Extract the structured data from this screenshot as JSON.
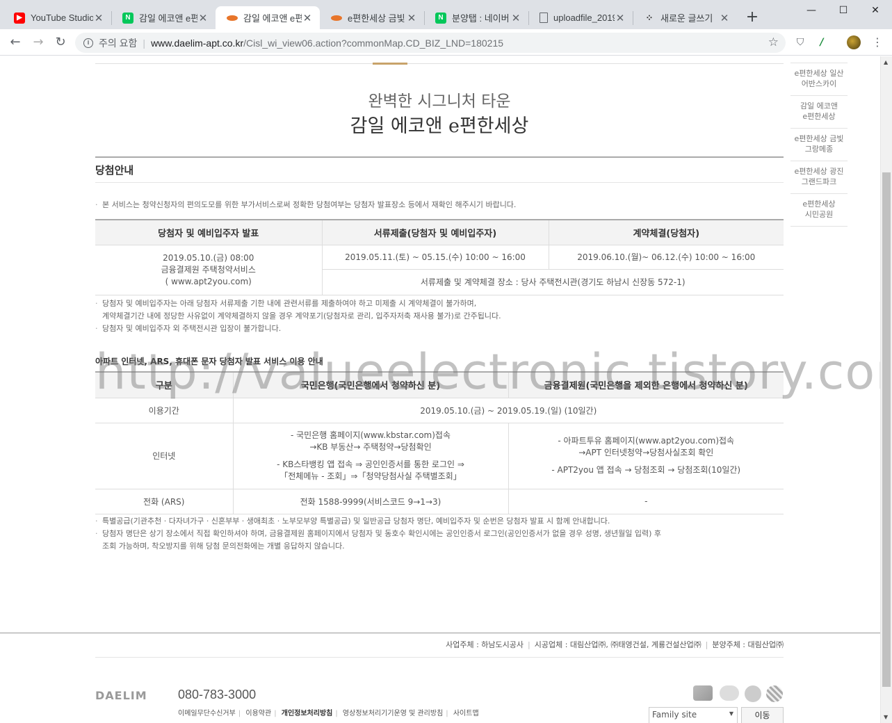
{
  "browser": {
    "tabs": [
      {
        "title": "YouTube Studio",
        "icon": "youtube-icon",
        "color": "#ff0000"
      },
      {
        "title": "감일 에코앤 e편",
        "icon": "naver-icon",
        "color": "#03c75a"
      },
      {
        "title": "감일 에코앤 e편",
        "icon": "daelim-icon",
        "color": "#e8752a",
        "active": true
      },
      {
        "title": "e편한세상 금빛",
        "icon": "daelim-icon",
        "color": "#e8752a"
      },
      {
        "title": "분양탭 : 네이버",
        "icon": "naver-icon",
        "color": "#03c75a"
      },
      {
        "title": "uploadfile_2019",
        "icon": "document-icon",
        "color": "#5f6368"
      },
      {
        "title": "새로운 글쓰기",
        "icon": "tistory-icon",
        "color": "#333333"
      }
    ],
    "security_warning": "주의 요함",
    "url_host": "www.daelim-apt.co.kr",
    "url_path": "/Cisl_wi_view06.action?commonMap.CD_BIZ_LND=180215"
  },
  "hero": {
    "subtitle": "완벽한 시그니처 타운",
    "title": "감일 에코앤 e편한세상"
  },
  "section": {
    "title": "당첨안내",
    "intro_note": "본 서비스는 청약신청자의 편의도모를 위한 부가서비스로써 정확한 당첨여부는 당첨자 발표장소 등에서 재확인 해주시기 바랍니다."
  },
  "schedule_table": {
    "headers": [
      "당첨자 및 예비입주자 발표",
      "서류제출(당첨자 및 예비입주자)",
      "계약체결(당첨자)"
    ],
    "announce": [
      "2019.05.10.(금) 08:00",
      "금융결제원 주택청약서비스",
      "( www.apt2you.com)"
    ],
    "docs_period": "2019.05.11.(토) ~ 05.15.(수) 10:00 ~ 16:00",
    "contract_period": "2019.06.10.(월)~ 06.12.(수) 10:00 ~ 16:00",
    "place": "서류제출 및 계약체결 장소 : 당사 주택전시관(경기도 하남시 신장동 572-1)"
  },
  "notes_1": [
    "당첨자 및 예비입주자는 아래 당첨자 서류제출 기한 내에 관련서류를 제출하여야 하고 미제출 시 계약체결이 불가하며,",
    "계약체결기간 내에 정당한 사유없이 계약체결하지 않을 경우 계약포기(당첨자로 관리, 입주자저축 재사용 불가)로 간주됩니다.",
    "당첨자 및 예비입주자 외 주택전시관 입장이 불가합니다."
  ],
  "service": {
    "title": "아파트 인터넷, ARS, 휴대폰 문자 당첨자 발표 서비스 이용 안내",
    "headers": [
      "구분",
      "국민은행(국민은행에서 청약하신 분)",
      "금융결제원(국민은행을 제외한 은행에서 청약하신 분)"
    ],
    "period_label": "이용기간",
    "period_value": "2019.05.10.(금) ~ 2019.05.19.(일) (10일간)",
    "internet_label": "인터넷",
    "kb_internet": [
      "- 국민은행 홈페이지(www.kbstar.com)접속",
      "→KB 부동산→ 주택청약→당첨확인",
      "- KB스타뱅킹 앱 접속 ⇒ 공인인증서를 통한 로그인 ⇒",
      "「전체메뉴 - 조회」⇒「청약당첨사실 주택별조회」"
    ],
    "kftc_internet": [
      "- 아파트투유 홈페이지(www.apt2you.com)접속",
      "→APT 인터넷청약→당첨사실조회 확인",
      "- APT2you 앱 접속 → 당첨조회 → 당첨조회(10일간)"
    ],
    "ars_label": "전화 (ARS)",
    "kb_ars": "전화 1588-9999(서비스코드 9→1→3)",
    "kftc_ars": "-"
  },
  "notes_2": [
    "특별공급(기관추천 · 다자녀가구 · 신혼부부 · 생애최초 · 노부모부양 특별공급) 및 일반공급 당첨자 명단, 예비입주자 및 순번은 당첨자 발표 시 함께 안내합니다.",
    "당첨자 명단은 상기 장소에서 직접 확인하셔야 하며, 금융결제원 홈페이지에서 당첨자 및 동호수 확인시에는 공인인증서 로그인(공인인증서가 없을 경우 성명, 생년월일 입력) 후",
    "조회 가능하며, 착오방지를 위해 당첨 문의전화에는 개별 응답하지 않습니다."
  ],
  "quick_nav": [
    "e편한세상 일산\n어반스카이",
    "감일 에코앤\ne편한세상",
    "e편한세상 금빛\n그랑메종",
    "e편한세상 광진\n그랜드파크",
    "e편한세상\n시민공원"
  ],
  "watermark": "http://valueelectronic.tistory.com",
  "footer": {
    "developer": "사업주체 : 하남도시공사",
    "builder": "시공업체 : 대림산업㈜, ㈜태영건설, 계룡건설산업㈜",
    "seller": "분양주체 : 대림산업㈜",
    "logo": "DAELIM",
    "phone": "080-783-3000",
    "links": [
      "이메일무단수신거부",
      "이용약관",
      "개인정보처리방침",
      "영상정보처리기기운영 및 관리방침",
      "사이트맵"
    ],
    "family_site": "Family site",
    "go_label": "이동"
  }
}
